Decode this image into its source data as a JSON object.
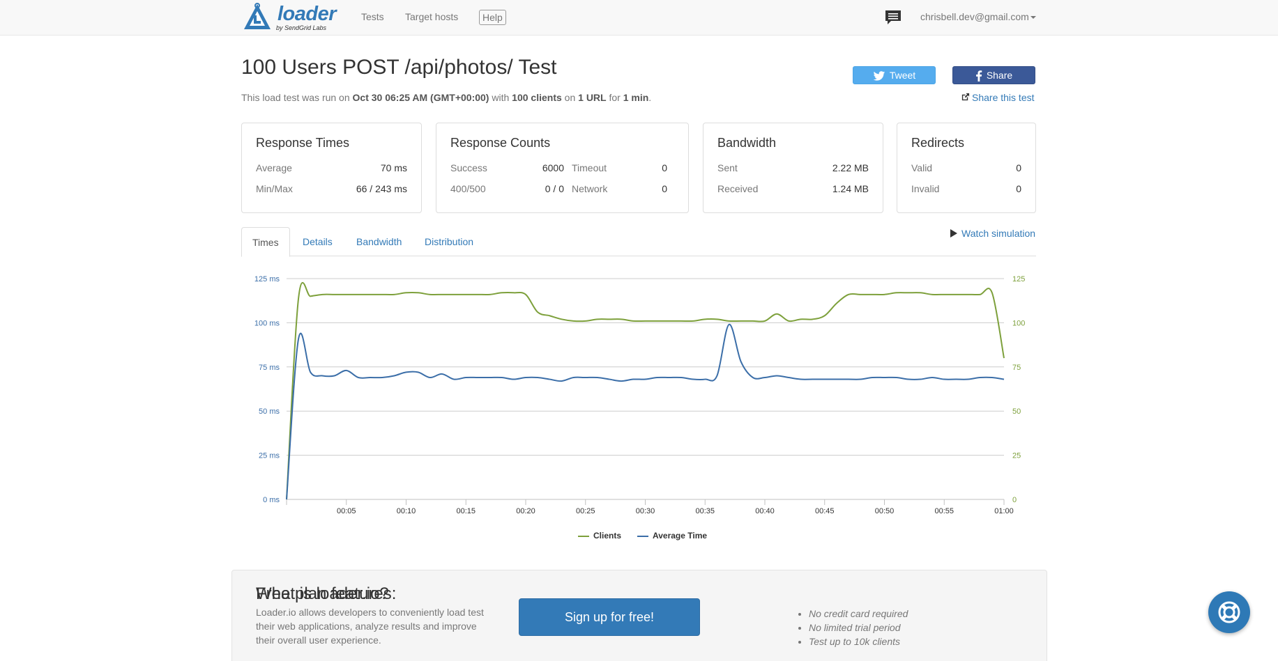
{
  "nav": {
    "logo_word": "loader",
    "logo_sub": "by SendGrid Labs",
    "links": [
      "Tests",
      "Target hosts"
    ],
    "help": "Help",
    "user_email": "chrisbell.dev@gmail.com",
    "icons": {
      "logo": "loader-logo-icon",
      "chat": "chat-icon"
    }
  },
  "header": {
    "title": "100 Users POST /api/photos/ Test",
    "run_prefix": "This load test was run on ",
    "run_date": "Oct 30 06:25 AM (GMT+00:00)",
    "run_with": " with ",
    "run_clients": "100 clients",
    "run_on": " on ",
    "run_urls": "1 URL",
    "run_for": " for ",
    "run_duration": "1 min",
    "run_end": ".",
    "tweet": "Tweet",
    "share": "Share",
    "share_test": "Share this test"
  },
  "panels": {
    "response_times": {
      "title": "Response Times",
      "avg_label": "Average",
      "avg_value": "70 ms",
      "minmax_label": "Min/Max",
      "minmax_value": "66 / 243 ms"
    },
    "response_counts": {
      "title": "Response Counts",
      "success_label": "Success",
      "success_value": "6000",
      "timeout_label": "Timeout",
      "timeout_value": "0",
      "err_label": "400/500",
      "err_value": "0 / 0",
      "network_label": "Network",
      "network_value": "0"
    },
    "bandwidth": {
      "title": "Bandwidth",
      "sent_label": "Sent",
      "sent_value": "2.22 MB",
      "recv_label": "Received",
      "recv_value": "1.24 MB"
    },
    "redirects": {
      "title": "Redirects",
      "valid_label": "Valid",
      "valid_value": "0",
      "invalid_label": "Invalid",
      "invalid_value": "0"
    }
  },
  "tabs": [
    "Times",
    "Details",
    "Bandwidth",
    "Distribution"
  ],
  "active_tab": "Times",
  "watch_simulation": "Watch simulation",
  "chart_data": {
    "type": "line",
    "x_ticks": [
      "00:05",
      "00:10",
      "00:15",
      "00:20",
      "00:25",
      "00:30",
      "00:35",
      "00:40",
      "00:45",
      "00:50",
      "00:55",
      "01:00"
    ],
    "x": [
      0,
      1,
      2,
      3,
      4,
      5,
      6,
      7,
      8,
      9,
      10,
      11,
      12,
      13,
      14,
      15,
      16,
      17,
      18,
      19,
      20,
      21,
      22,
      23,
      24,
      25,
      26,
      27,
      28,
      29,
      30,
      31,
      32,
      33,
      34,
      35,
      36,
      37,
      38,
      39,
      40,
      41,
      42,
      43,
      44,
      45,
      46,
      47,
      48,
      49,
      50,
      51,
      52,
      53,
      54,
      55,
      56,
      57,
      58,
      59,
      60
    ],
    "y_left_ticks": [
      "0 ms",
      "25 ms",
      "50 ms",
      "75 ms",
      "100 ms",
      "125 ms"
    ],
    "y_right_ticks": [
      "0",
      "25",
      "50",
      "75",
      "100",
      "125"
    ],
    "ylim": [
      0,
      125
    ],
    "series": [
      {
        "name": "Clients",
        "color": "#7da03b",
        "axis": "right",
        "values": [
          0,
          114,
          115,
          116,
          116,
          116,
          116,
          116,
          116,
          116,
          117,
          117,
          116,
          116,
          116,
          116,
          116,
          116,
          117,
          117,
          116,
          106,
          104,
          102,
          101,
          101,
          102,
          102,
          102,
          101,
          101,
          101,
          101,
          101,
          101,
          102,
          102,
          101,
          101,
          101,
          101,
          105,
          101,
          102,
          102,
          104,
          111,
          116,
          116,
          116,
          116,
          117,
          117,
          117,
          116,
          116,
          116,
          116,
          116,
          117,
          80
        ]
      },
      {
        "name": "Average Time",
        "color": "#3b6ea8",
        "axis": "left",
        "values": [
          0,
          91,
          72,
          70,
          70,
          73,
          69,
          69,
          69,
          70,
          72,
          72,
          69,
          71,
          68,
          69,
          69,
          69,
          69,
          68,
          69,
          69,
          68,
          67,
          69,
          69,
          69,
          68,
          67,
          68,
          68,
          69,
          69,
          69,
          68,
          68,
          70,
          99,
          78,
          69,
          69,
          70,
          69,
          68,
          68,
          68,
          68,
          68,
          68,
          69,
          69,
          69,
          68,
          68,
          69,
          68,
          68,
          68,
          69,
          69,
          68
        ]
      }
    ]
  },
  "promo": {
    "title": "What is loader.io?",
    "text": "Loader.io allows developers to conveniently load test their web applications, analyze results and improve their overall user experience.",
    "signup": "Sign up for free!",
    "features_title": "Free plan features:",
    "features": [
      "No credit card required",
      "No limited trial period",
      "Test up to 10k clients"
    ]
  }
}
